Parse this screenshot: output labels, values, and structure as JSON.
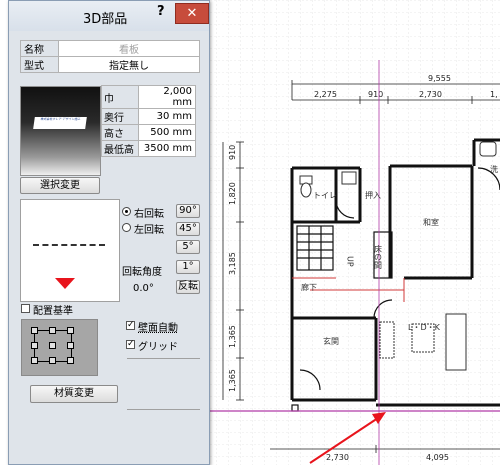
{
  "dialog": {
    "title": "3D部品",
    "help_label": "?",
    "close_label": "✕",
    "name_label": "名称",
    "name_value": "看板",
    "type_label": "型式",
    "type_value": "指定無し",
    "preview_card_text": "株式会社クレア デザイン施工",
    "dimensions": [
      {
        "label": "巾",
        "value": "2,000 mm"
      },
      {
        "label": "奥行",
        "value": "30 mm"
      },
      {
        "label": "高さ",
        "value": "500 mm"
      },
      {
        "label": "最低高",
        "value": "3500 mm"
      }
    ],
    "select_change_button": "選択変更",
    "rotate_right_label": "右回転",
    "rotate_left_label": "左回転",
    "rotate_right_selected": true,
    "angle_buttons": [
      "90°",
      "45°",
      "5°",
      "1°"
    ],
    "rotation_angle_label": "回転角度",
    "rotation_angle_value": "0.0°",
    "flip_button": "反転",
    "placement_base_label": "配置基準",
    "placement_base_checked": false,
    "wall_auto_label": "壁面自動",
    "wall_auto_checked": true,
    "grid_label": "グリッド",
    "grid_checked": true,
    "material_change_button": "材質変更"
  },
  "floorplan": {
    "dim_total": "9,555",
    "dim_top": [
      "2,275",
      "910",
      "2,730",
      "1,"
    ],
    "dim_left": [
      "910",
      "1,820",
      "3,185",
      "1,365",
      "1,365"
    ],
    "dim_bottom": [
      "2,730",
      "4,095"
    ],
    "rooms": {
      "toilet": "トイレ",
      "closet": "押入",
      "washitsu": "和室",
      "tokonoma": "床の間",
      "up": "UP",
      "hallway": "廊下",
      "ldk": "L・D・K",
      "entrance": "玄関",
      "wash": "洗"
    }
  },
  "colors": {
    "arrow": "#e8141c",
    "close_button": "#c74c3c",
    "selection_line": "#b03aa6",
    "grid": "#d0d0d0"
  }
}
